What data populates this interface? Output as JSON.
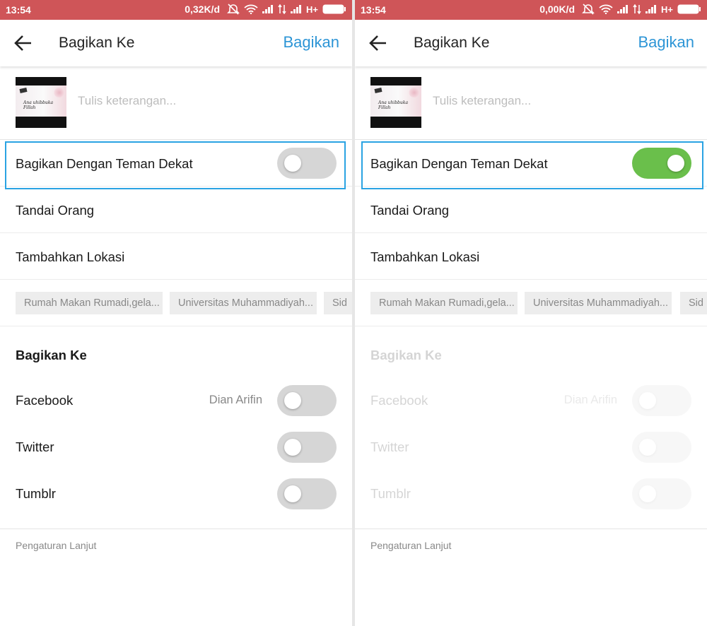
{
  "panels": [
    {
      "status": {
        "time": "13:54",
        "speed": "0,32K/d",
        "network": "H+"
      },
      "header": {
        "title": "Bagikan Ke",
        "action": "Bagikan"
      },
      "media": {
        "thumbnail_text": "Ana uhibbuka Fillah",
        "caption_placeholder": "Tulis keterangan..."
      },
      "close_friends": {
        "label": "Bagikan Dengan Teman Dekat",
        "enabled": false
      },
      "tag_people": "Tandai Orang",
      "add_location": "Tambahkan Lokasi",
      "location_chips": [
        "Rumah Makan Rumadi,gela...",
        "Universitas Muhammadiyah...",
        "Sid"
      ],
      "share_section": {
        "title": "Bagikan Ke",
        "items": [
          {
            "label": "Facebook",
            "account": "Dian Arifin",
            "enabled": false
          },
          {
            "label": "Twitter",
            "account": "",
            "enabled": false
          },
          {
            "label": "Tumblr",
            "account": "",
            "enabled": false
          }
        ],
        "disabled": false
      },
      "advanced": "Pengaturan Lanjut"
    },
    {
      "status": {
        "time": "13:54",
        "speed": "0,00K/d",
        "network": "H+"
      },
      "header": {
        "title": "Bagikan Ke",
        "action": "Bagikan"
      },
      "media": {
        "thumbnail_text": "Ana uhibbuka Fillah",
        "caption_placeholder": "Tulis keterangan..."
      },
      "close_friends": {
        "label": "Bagikan Dengan Teman Dekat",
        "enabled": true
      },
      "tag_people": "Tandai Orang",
      "add_location": "Tambahkan Lokasi",
      "location_chips": [
        "Rumah Makan Rumadi,gela...",
        "Universitas Muhammadiyah...",
        "Sid"
      ],
      "share_section": {
        "title": "Bagikan Ke",
        "items": [
          {
            "label": "Facebook",
            "account": "Dian Arifin",
            "enabled": false
          },
          {
            "label": "Twitter",
            "account": "",
            "enabled": false
          },
          {
            "label": "Tumblr",
            "account": "",
            "enabled": false
          }
        ],
        "disabled": true
      },
      "advanced": "Pengaturan Lanjut"
    }
  ],
  "colors": {
    "statusbar": "#cf5558",
    "accent": "#2d95d6",
    "toggle_on": "#6abf4b",
    "highlight": "#2aa3e3"
  },
  "icons": [
    "back-arrow-icon",
    "wifi-icon",
    "signal-icon",
    "battery-icon",
    "mute-icon"
  ]
}
